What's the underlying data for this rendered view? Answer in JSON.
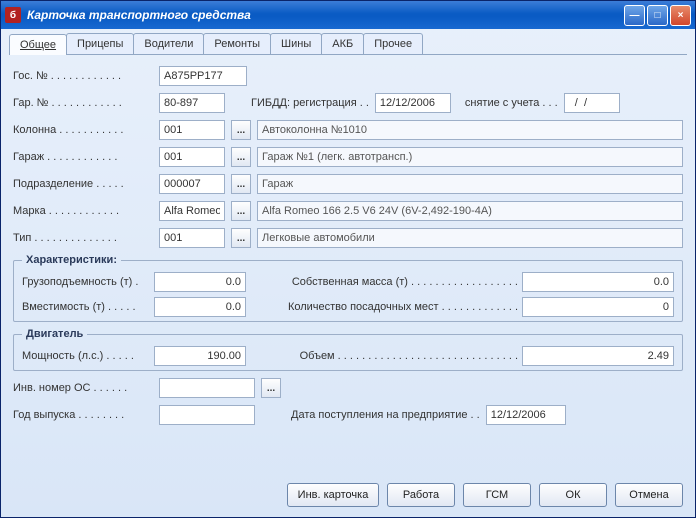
{
  "window_title": "Карточка транспортного средства",
  "tabs": [
    "Общее",
    "Прицепы",
    "Водители",
    "Ремонты",
    "Шины",
    "АКБ",
    "Прочее"
  ],
  "labels": {
    "gos_no": "Гос. № . . . . . . . . . . . .",
    "gar_no": "Гар. № . . . . . . . . . . . .",
    "gibdd_reg": "ГИБДД: регистрация . .",
    "gibdd_off": "снятие с учета . . .",
    "kolonna": "Колонна . . . . . . . . . . .",
    "garazh": "Гараж . . . . . . . . . . . .",
    "podrazd": "Подразделение . . . . .",
    "marka": "Марка . . . . . . . . . . . .",
    "tip": "Тип . . . . . . . . . . . . . .",
    "char_legend": "Характеристики:",
    "gruz": "Грузоподъемность (т) .",
    "sobmass": "Собственная масса (т) . . . . . . . . . . . . . . . . . .",
    "vmest": "Вместимость (т) . . . . .",
    "posad": "Количество посадочных мест . . . . . . . . . . . . .",
    "engine_legend": "Двигатель",
    "power": "Мощность (л.с.) . . . . .",
    "volume": "Объем . . . . . . . . . . . . . . . . . . . . . . . . . . . . . .",
    "inv_os": "Инв. номер ОС . . . . . .",
    "year": "Год выпуска . . . . . . . .",
    "date_in": "Дата поступления на предприятие . ."
  },
  "fields": {
    "gos_no": "А875РР177",
    "gar_no": "80-897",
    "gibdd_reg": "12/12/2006",
    "gibdd_off": "  /  /",
    "kolonna_code": "001",
    "kolonna_desc": "Автоколонна №1010",
    "garazh_code": "001",
    "garazh_desc": "Гараж №1 (легк. автотрансп.)",
    "podrazd_code": "000007",
    "podrazd_desc": "Гараж",
    "marka_code": "Alfa Romeo",
    "marka_desc": "Alfa Romeo 166 2.5 V6 24V (6V-2,492-190-4A)",
    "tip_code": "001",
    "tip_desc": "Легковые автомобили",
    "gruz": "0.0",
    "sobmass": "0.0",
    "vmest": "0.0",
    "posad": "0",
    "power": "190.00",
    "volume": "2.49",
    "inv_os": "",
    "year": "",
    "date_in": "12/12/2006"
  },
  "buttons": {
    "inv": "Инв. карточка",
    "work": "Работа",
    "gsm": "ГСМ",
    "ok": "ОК",
    "cancel": "Отмена"
  },
  "picker": "..."
}
